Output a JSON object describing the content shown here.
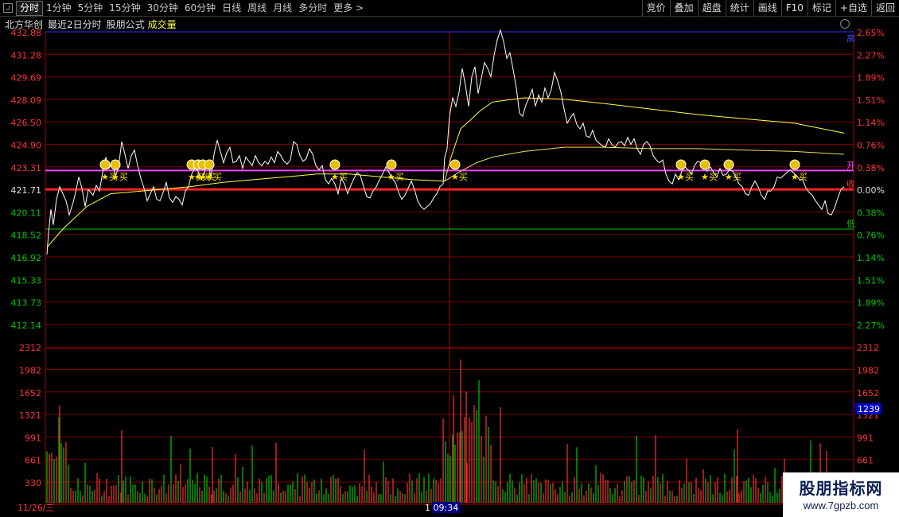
{
  "toolbar": {
    "tabs": [
      "分时",
      "1分钟",
      "5分钟",
      "15分钟",
      "30分钟",
      "60分钟",
      "日线",
      "周线",
      "月线",
      "多分时",
      "更多 >"
    ],
    "right_buttons": [
      "竞价",
      "叠加",
      "超盘",
      "统计",
      "画线",
      "F10",
      "标记",
      "+自选",
      "返回"
    ]
  },
  "info": {
    "stock": "北方华创",
    "period": "最近2日分时",
    "formula": "股朋公式",
    "volume_label": "成交量"
  },
  "colors": {
    "up": "#ff3232",
    "down": "#00c800",
    "price": "#ffffff",
    "avg": "#ffff40",
    "open_line": "#ff2020",
    "high_line": "#ff40ff",
    "low_line": "#00c800",
    "grid": "#7a0000",
    "marker": "#ffe000"
  },
  "chart_data": {
    "type": "line",
    "price_ticks_left": [
      "432.88",
      "431.28",
      "429.69",
      "428.09",
      "426.50",
      "424.90",
      "423.31",
      "421.71",
      "420.11",
      "418.52",
      "416.92",
      "415.33",
      "413.73",
      "412.14"
    ],
    "pct_ticks_right": [
      "2.65%",
      "2.27%",
      "1.89%",
      "1.51%",
      "1.14%",
      "0.76%",
      "0.38%",
      "0.00%",
      "0.38%",
      "0.76%",
      "1.14%",
      "1.51%",
      "1.89%",
      "2.27%"
    ],
    "pct_colors": [
      "up",
      "up",
      "up",
      "up",
      "up",
      "up",
      "up",
      "neutral",
      "down",
      "down",
      "down",
      "down",
      "down",
      "down"
    ],
    "volume_ticks": [
      "2312",
      "1982",
      "1652",
      "1321",
      "991",
      "661",
      "330"
    ],
    "prev_close": 421.71,
    "ylim": [
      412.14,
      432.88
    ],
    "level_lines": [
      {
        "label": "高",
        "value": 432.88
      },
      {
        "label": "开",
        "value": 423.05
      },
      {
        "label": "收",
        "value": 421.71
      },
      {
        "label": "低",
        "value": 418.9
      }
    ],
    "days": [
      "11/26/三",
      "1 09:34"
    ],
    "current_volume": "1239",
    "price_series": [
      [
        0,
        417.1
      ],
      [
        2,
        418.6
      ],
      [
        5,
        420.3
      ],
      [
        8,
        419.2
      ],
      [
        12,
        421.0
      ],
      [
        16,
        421.9
      ],
      [
        20,
        421.4
      ],
      [
        24,
        420.9
      ],
      [
        28,
        419.9
      ],
      [
        33,
        420.8
      ],
      [
        36,
        421.5
      ],
      [
        40,
        422.6
      ],
      [
        44,
        421.8
      ],
      [
        48,
        420.5
      ],
      [
        52,
        421.7
      ],
      [
        58,
        421.3
      ],
      [
        62,
        422.0
      ],
      [
        66,
        421.6
      ],
      [
        70,
        422.9
      ],
      [
        74,
        424.0
      ],
      [
        78,
        423.2
      ],
      [
        82,
        423.7
      ],
      [
        86,
        422.6
      ],
      [
        90,
        423.3
      ],
      [
        94,
        425.1
      ],
      [
        98,
        424.2
      ],
      [
        102,
        423.2
      ],
      [
        106,
        424.1
      ],
      [
        110,
        424.5
      ],
      [
        114,
        423.4
      ],
      [
        118,
        422.5
      ],
      [
        122,
        421.8
      ],
      [
        126,
        420.9
      ],
      [
        130,
        421.4
      ],
      [
        134,
        421.9
      ],
      [
        138,
        421.0
      ],
      [
        142,
        420.9
      ],
      [
        146,
        421.5
      ],
      [
        150,
        422.2
      ],
      [
        154,
        421.1
      ],
      [
        158,
        420.8
      ],
      [
        162,
        421.2
      ],
      [
        166,
        421.0
      ],
      [
        170,
        420.6
      ],
      [
        174,
        421.6
      ],
      [
        178,
        421.9
      ],
      [
        182,
        422.8
      ],
      [
        186,
        423.2
      ],
      [
        190,
        423.0
      ],
      [
        194,
        422.4
      ],
      [
        198,
        422.9
      ],
      [
        202,
        423.7
      ],
      [
        206,
        422.6
      ],
      [
        210,
        424.2
      ],
      [
        214,
        425.2
      ],
      [
        218,
        424.4
      ],
      [
        222,
        423.6
      ],
      [
        226,
        424.3
      ],
      [
        230,
        424.7
      ],
      [
        234,
        423.6
      ],
      [
        238,
        423.7
      ],
      [
        242,
        424.1
      ],
      [
        246,
        423.2
      ],
      [
        250,
        424.0
      ],
      [
        254,
        423.7
      ],
      [
        258,
        423.4
      ],
      [
        262,
        424.1
      ],
      [
        266,
        423.6
      ],
      [
        270,
        423.4
      ],
      [
        274,
        423.7
      ],
      [
        278,
        423.5
      ],
      [
        282,
        424.0
      ],
      [
        286,
        423.6
      ],
      [
        290,
        424.4
      ],
      [
        294,
        424.1
      ],
      [
        298,
        423.7
      ],
      [
        302,
        423.5
      ],
      [
        306,
        423.8
      ],
      [
        310,
        425.1
      ],
      [
        314,
        424.9
      ],
      [
        318,
        424.1
      ],
      [
        322,
        423.7
      ],
      [
        326,
        423.9
      ],
      [
        330,
        424.6
      ],
      [
        334,
        424.2
      ],
      [
        338,
        423.4
      ],
      [
        342,
        423.1
      ],
      [
        346,
        423.4
      ],
      [
        350,
        422.4
      ],
      [
        354,
        422.1
      ],
      [
        358,
        422.5
      ],
      [
        362,
        422.1
      ],
      [
        366,
        421.4
      ],
      [
        370,
        422.5
      ],
      [
        374,
        422.1
      ],
      [
        378,
        421.4
      ],
      [
        382,
        422.0
      ],
      [
        386,
        422.5
      ],
      [
        390,
        422.9
      ],
      [
        394,
        422.7
      ],
      [
        398,
        421.9
      ],
      [
        402,
        421.2
      ],
      [
        406,
        421.1
      ],
      [
        410,
        421.6
      ],
      [
        414,
        421.9
      ],
      [
        418,
        422.4
      ],
      [
        422,
        422.8
      ],
      [
        426,
        423.3
      ],
      [
        430,
        422.9
      ],
      [
        434,
        422.5
      ],
      [
        438,
        422.2
      ],
      [
        442,
        421.5
      ],
      [
        446,
        421.0
      ],
      [
        450,
        421.3
      ],
      [
        454,
        421.8
      ],
      [
        458,
        422.3
      ],
      [
        462,
        421.7
      ],
      [
        466,
        420.9
      ],
      [
        470,
        420.5
      ],
      [
        474,
        420.3
      ],
      [
        478,
        420.5
      ],
      [
        482,
        420.7
      ],
      [
        486,
        421.1
      ],
      [
        490,
        421.4
      ],
      [
        494,
        421.9
      ],
      [
        498,
        422.1
      ],
      [
        500,
        424.0
      ],
      [
        503,
        424.6
      ],
      [
        506,
        426.9
      ],
      [
        510,
        428.2
      ],
      [
        514,
        427.6
      ],
      [
        518,
        428.6
      ],
      [
        522,
        430.3
      ],
      [
        526,
        429.1
      ],
      [
        530,
        427.6
      ],
      [
        534,
        429.7
      ],
      [
        538,
        430.4
      ],
      [
        542,
        428.5
      ],
      [
        546,
        429.6
      ],
      [
        550,
        430.7
      ],
      [
        554,
        430.3
      ],
      [
        558,
        429.7
      ],
      [
        562,
        431.2
      ],
      [
        566,
        432.3
      ],
      [
        570,
        433.0
      ],
      [
        574,
        432.2
      ],
      [
        578,
        431.0
      ],
      [
        582,
        431.4
      ],
      [
        586,
        430.2
      ],
      [
        590,
        428.9
      ],
      [
        594,
        427.1
      ],
      [
        598,
        426.9
      ],
      [
        602,
        427.7
      ],
      [
        606,
        428.2
      ],
      [
        610,
        428.8
      ],
      [
        614,
        427.6
      ],
      [
        618,
        428.4
      ],
      [
        622,
        427.9
      ],
      [
        626,
        428.9
      ],
      [
        630,
        428.2
      ],
      [
        634,
        428.8
      ],
      [
        638,
        430.0
      ],
      [
        642,
        429.4
      ],
      [
        646,
        428.6
      ],
      [
        650,
        427.4
      ],
      [
        654,
        426.4
      ],
      [
        658,
        426.8
      ],
      [
        662,
        427.1
      ],
      [
        666,
        426.3
      ],
      [
        670,
        426.0
      ],
      [
        674,
        426.4
      ],
      [
        678,
        425.5
      ],
      [
        682,
        425.4
      ],
      [
        686,
        425.9
      ],
      [
        690,
        425.2
      ],
      [
        694,
        425.0
      ],
      [
        698,
        424.8
      ],
      [
        702,
        424.7
      ],
      [
        706,
        425.3
      ],
      [
        710,
        424.9
      ],
      [
        714,
        424.7
      ],
      [
        718,
        425.0
      ],
      [
        722,
        425.1
      ],
      [
        726,
        424.8
      ],
      [
        730,
        425.4
      ],
      [
        734,
        424.9
      ],
      [
        738,
        425.3
      ],
      [
        742,
        424.6
      ],
      [
        746,
        424.2
      ],
      [
        750,
        424.9
      ],
      [
        754,
        425.1
      ],
      [
        758,
        424.8
      ],
      [
        762,
        424.1
      ],
      [
        766,
        423.8
      ],
      [
        770,
        423.6
      ],
      [
        774,
        423.8
      ],
      [
        778,
        422.8
      ],
      [
        782,
        422.3
      ],
      [
        786,
        422.1
      ],
      [
        790,
        422.8
      ],
      [
        794,
        422.4
      ],
      [
        798,
        423.0
      ],
      [
        802,
        423.3
      ],
      [
        806,
        423.1
      ],
      [
        810,
        422.8
      ],
      [
        814,
        423.4
      ],
      [
        818,
        423.7
      ],
      [
        822,
        423.6
      ],
      [
        826,
        423.5
      ],
      [
        830,
        423.0
      ],
      [
        834,
        423.3
      ],
      [
        838,
        422.9
      ],
      [
        842,
        422.6
      ],
      [
        846,
        423.2
      ],
      [
        850,
        422.7
      ],
      [
        854,
        422.8
      ],
      [
        858,
        423.1
      ],
      [
        862,
        423.0
      ],
      [
        866,
        422.6
      ],
      [
        870,
        422.1
      ],
      [
        874,
        421.9
      ],
      [
        878,
        421.4
      ],
      [
        882,
        421.3
      ],
      [
        886,
        421.9
      ],
      [
        890,
        422.3
      ],
      [
        894,
        421.9
      ],
      [
        898,
        421.3
      ],
      [
        902,
        421.0
      ],
      [
        906,
        421.6
      ],
      [
        910,
        421.6
      ],
      [
        914,
        421.9
      ],
      [
        918,
        422.6
      ],
      [
        922,
        422.5
      ],
      [
        926,
        422.7
      ],
      [
        930,
        422.9
      ],
      [
        934,
        423.1
      ],
      [
        938,
        422.9
      ],
      [
        942,
        422.7
      ],
      [
        946,
        422.4
      ],
      [
        950,
        422.4
      ],
      [
        954,
        421.8
      ],
      [
        958,
        421.5
      ],
      [
        962,
        421.3
      ],
      [
        966,
        420.9
      ],
      [
        970,
        420.6
      ],
      [
        974,
        420.3
      ],
      [
        978,
        420.9
      ],
      [
        982,
        420.0
      ],
      [
        986,
        419.9
      ],
      [
        990,
        420.4
      ],
      [
        994,
        421.1
      ],
      [
        998,
        421.7
      ],
      [
        1002,
        421.9
      ]
    ],
    "avg_series": [
      [
        0,
        417.6
      ],
      [
        20,
        418.9
      ],
      [
        50,
        420.5
      ],
      [
        80,
        421.4
      ],
      [
        120,
        421.6
      ],
      [
        180,
        421.9
      ],
      [
        220,
        422.2
      ],
      [
        260,
        422.4
      ],
      [
        300,
        422.6
      ],
      [
        340,
        422.8
      ],
      [
        380,
        422.8
      ],
      [
        420,
        422.6
      ],
      [
        460,
        422.4
      ],
      [
        500,
        422.3
      ],
      [
        508,
        424.0
      ],
      [
        520,
        426.0
      ],
      [
        545,
        427.3
      ],
      [
        560,
        427.9
      ],
      [
        600,
        428.2
      ],
      [
        650,
        428.1
      ],
      [
        700,
        427.8
      ],
      [
        760,
        427.4
      ],
      [
        820,
        427.0
      ],
      [
        880,
        426.7
      ],
      [
        940,
        426.4
      ],
      [
        1002,
        425.7
      ]
    ],
    "avg_series2": [
      [
        500,
        422.3
      ],
      [
        520,
        423.0
      ],
      [
        540,
        423.6
      ],
      [
        560,
        424.0
      ],
      [
        600,
        424.4
      ],
      [
        650,
        424.7
      ],
      [
        700,
        424.7
      ],
      [
        760,
        424.6
      ],
      [
        820,
        424.6
      ],
      [
        880,
        424.5
      ],
      [
        940,
        424.4
      ],
      [
        1002,
        424.2
      ]
    ],
    "signals": [
      {
        "x": 73,
        "label": "★买"
      },
      {
        "x": 86,
        "label": "★买"
      },
      {
        "x": 182,
        "label": "★买"
      },
      {
        "x": 190,
        "label": "★买"
      },
      {
        "x": 196,
        "label": "★买"
      },
      {
        "x": 204,
        "label": "★买"
      },
      {
        "x": 362,
        "label": "★买"
      },
      {
        "x": 433,
        "label": "★买"
      },
      {
        "x": 513,
        "label": "★买"
      },
      {
        "x": 797,
        "label": "★买"
      },
      {
        "x": 827,
        "label": "★买"
      },
      {
        "x": 857,
        "label": "★买"
      },
      {
        "x": 940,
        "label": "★买"
      }
    ]
  },
  "watermark": {
    "title": "股朋指标网",
    "url": "www.7gpzb.com"
  }
}
